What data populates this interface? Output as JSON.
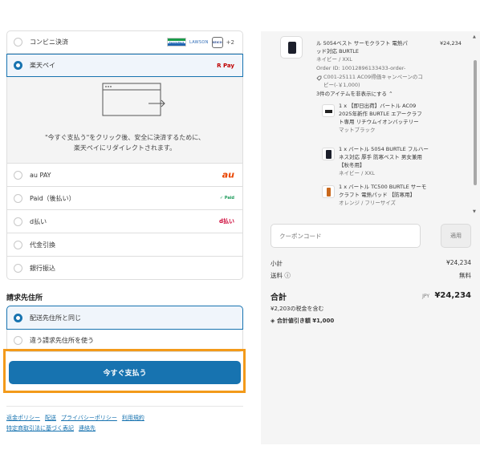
{
  "payment_methods": [
    {
      "label": "コンビニ決済",
      "selected": false,
      "logos": {
        "famima": "FamilyMart",
        "lawson": "LAWSON",
        "seico": "Seicomart",
        "more": "+2"
      }
    },
    {
      "label": "楽天ペイ",
      "selected": true,
      "logo": "R Pay"
    },
    {
      "label": "au PAY",
      "selected": false,
      "logo": "au"
    },
    {
      "label": "Paid（後払い）",
      "selected": false,
      "logo": "✓ Paid"
    },
    {
      "label": "d払い",
      "selected": false,
      "logo": "d払い"
    },
    {
      "label": "代金引換",
      "selected": false
    },
    {
      "label": "銀行振込",
      "selected": false
    }
  ],
  "rakuten_redirect": {
    "line1": "\"今すぐ支払う\"をクリック後、安全に決済するために、",
    "line2": "楽天ペイにリダイレクトされます。"
  },
  "billing": {
    "title": "請求先住所",
    "options": [
      {
        "label": "配送先住所と同じ",
        "selected": true
      },
      {
        "label": "違う請求先住所を使う",
        "selected": false
      }
    ]
  },
  "pay_button": "今すぐ支払う",
  "footer_links": [
    "返金ポリシー",
    "配送",
    "プライバシーポリシー",
    "利用規約",
    "特定商取引法に基づく表記",
    "連絡先"
  ],
  "order": {
    "main_item": {
      "title_line1": "ル 5054ベスト サーモクラフト 電熱パ",
      "title_line2": "ッド対応 BURTLE",
      "price": "¥24,234",
      "variant": "ネイビー / XXL",
      "order_id": "Order ID: 10012896133433-order-",
      "campaign_line1": "C001-25111 AC09得価キャンペーンのコ",
      "campaign_line2": "ピー(-￥1,000)",
      "hide_items": "3件のアイテムを非表示にする"
    },
    "sub_items": [
      {
        "lines": [
          "1 x 【即日出荷】バートル AC09",
          "2025年新作 BURTLE エアークラフ",
          "ト専用 リチウムイオンバッテリー"
        ],
        "variant": "マットブラック"
      },
      {
        "lines": [
          "1 x バートル 5054 BURTLE フルハー",
          "ネス対応 厚手 防寒ベスト 男女兼用",
          "【秋冬用】"
        ],
        "variant": "ネイビー / XXL"
      },
      {
        "lines": [
          "1 x バートル TC500 BURTLE サーモ",
          "クラフト 電熱パッド 【防寒用】"
        ],
        "variant": "オレンジ / フリーサイズ"
      }
    ],
    "coupon_placeholder": "クーポンコード",
    "apply_label": "適用",
    "subtotal_label": "小計",
    "subtotal_value": "¥24,234",
    "shipping_label": "送料 ⓘ",
    "shipping_value": "無料",
    "total_label": "合計",
    "currency": "JPY",
    "total_value": "¥24,234",
    "tax_note": "¥2,203の税金を含む",
    "discount_label": "合計値引き額",
    "discount_value": "¥1,000"
  },
  "colors": {
    "accent": "#1773b0",
    "highlight": "#f39a1a",
    "sidebar_bg": "#f5f5f5"
  }
}
